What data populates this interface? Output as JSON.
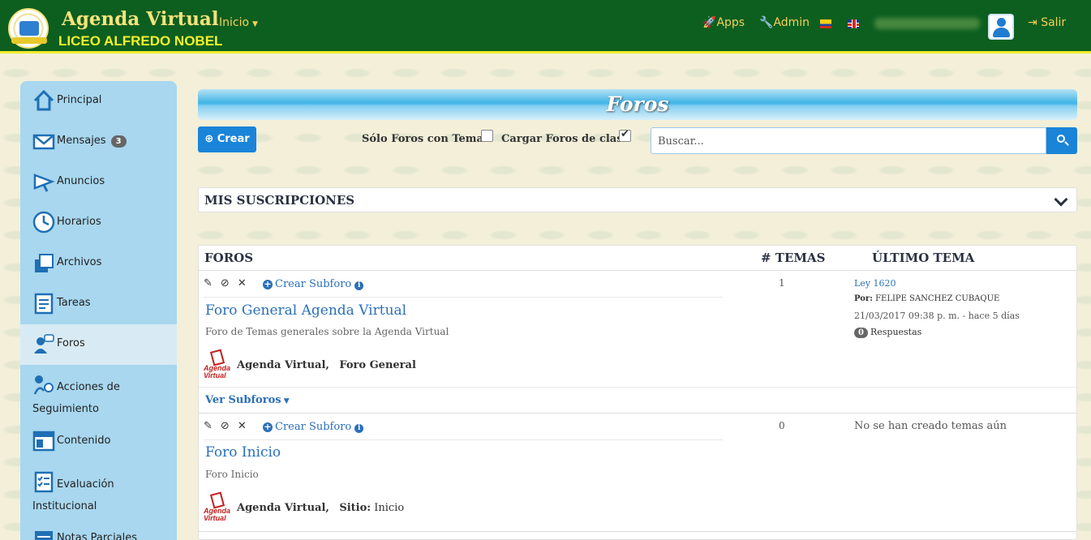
{
  "header": {
    "title": "Agenda Virtual",
    "school": "LICEO ALFREDO NOBEL",
    "nav_inicio": "Inicio",
    "apps": "Apps",
    "admin": "Admin",
    "logout": "Salir"
  },
  "sidebar": {
    "items": [
      {
        "label": "Principal"
      },
      {
        "label": "Mensajes",
        "badge": "3"
      },
      {
        "label": "Anuncios"
      },
      {
        "label": "Horarios"
      },
      {
        "label": "Archivos"
      },
      {
        "label": "Tareas"
      },
      {
        "label": "Foros"
      },
      {
        "label": "Acciones de Seguimiento"
      },
      {
        "label": "Contenido"
      },
      {
        "label": "Evaluación Institucional"
      },
      {
        "label": "Notas Parciales"
      }
    ]
  },
  "main": {
    "banner_title": "Foros",
    "create_label": "Crear",
    "only_with_topics_label": "Sólo Foros con Temas",
    "only_with_topics_checked": false,
    "load_class_forums_label": "Cargar Foros de clase",
    "load_class_forums_checked": true,
    "search_placeholder": "Buscar...",
    "subscriptions_title": "MIS SUSCRIPCIONES",
    "table": {
      "col_forums": "FOROS",
      "col_topics": "# TEMAS",
      "col_last": "ÚLTIMO TEMA"
    },
    "create_subforum_label": "Crear Subforo",
    "forums": [
      {
        "title": "Foro General Agenda Virtual",
        "description": "Foro de Temas generales sobre la Agenda Virtual",
        "tag1": "Agenda Virtual,",
        "tag2_label": "Foro General",
        "tag2_value": "",
        "topics": "1",
        "last_topic": "Ley 1620",
        "last_by_label": "Por:",
        "last_by": "FELIPE SANCHEZ CUBAQUE",
        "last_date": "21/03/2017 09:38 p. m. - hace 5 días",
        "replies": "0",
        "replies_label": "Respuestas",
        "see_subforums": "Ver Subforos"
      },
      {
        "title": "Foro Inicio",
        "description": "Foro Inicio",
        "tag1": "Agenda Virtual,",
        "tag2_label": "Sitio:",
        "tag2_value": "Inicio",
        "topics": "0",
        "no_topics": "No se han creado temas aún"
      }
    ],
    "logo_text_line1": "Agenda",
    "logo_text_line2": "Virtual"
  },
  "colors": {
    "header_green": "#0c5f1f",
    "header_yellow": "#f6f12c",
    "sidebar_blue": "#a8d7ef",
    "accent_blue": "#1a84d8"
  }
}
